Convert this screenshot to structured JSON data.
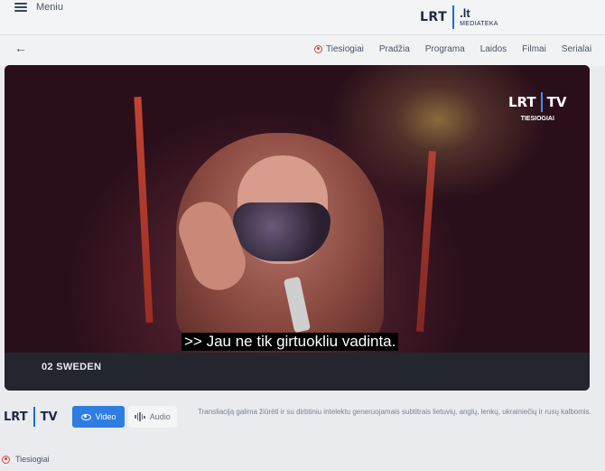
{
  "header": {
    "menu_label": "Meniu",
    "logo_left": "LRT",
    "logo_domain": ".lt",
    "logo_sub": "MEDIATEKA"
  },
  "nav": {
    "back_symbol": "←",
    "items": [
      "Tiesiogiai",
      "Pradžia",
      "Programa",
      "Laidos",
      "Filmai",
      "Serialai"
    ]
  },
  "player": {
    "channel_logo_left": "LRT",
    "channel_logo_right": "TV",
    "channel_live": "TIESIOGIAI",
    "subtitle": ">> Jau ne tik girtuokliu vadinta.",
    "program_title": "02 SWEDEN"
  },
  "controls": {
    "logo_left": "LRT",
    "logo_right": "TV",
    "video_label": "Video",
    "audio_label": "Audio",
    "note": "Transliaciją galima žiūrėti ir su dirbtiniu intelektu generuojamais subtitrais lietuvių, anglų, lenkų, ukrainiečių ir rusų kalbomis."
  },
  "footer": {
    "live_label": "Tiesiogiai"
  },
  "colors": {
    "accent": "#2f7de1",
    "live": "#e0413a"
  },
  "icons": {
    "menu": "hamburger-icon",
    "back": "arrow-left-icon",
    "live": "live-dot-icon",
    "video": "eye-icon",
    "audio": "waveform-icon"
  }
}
